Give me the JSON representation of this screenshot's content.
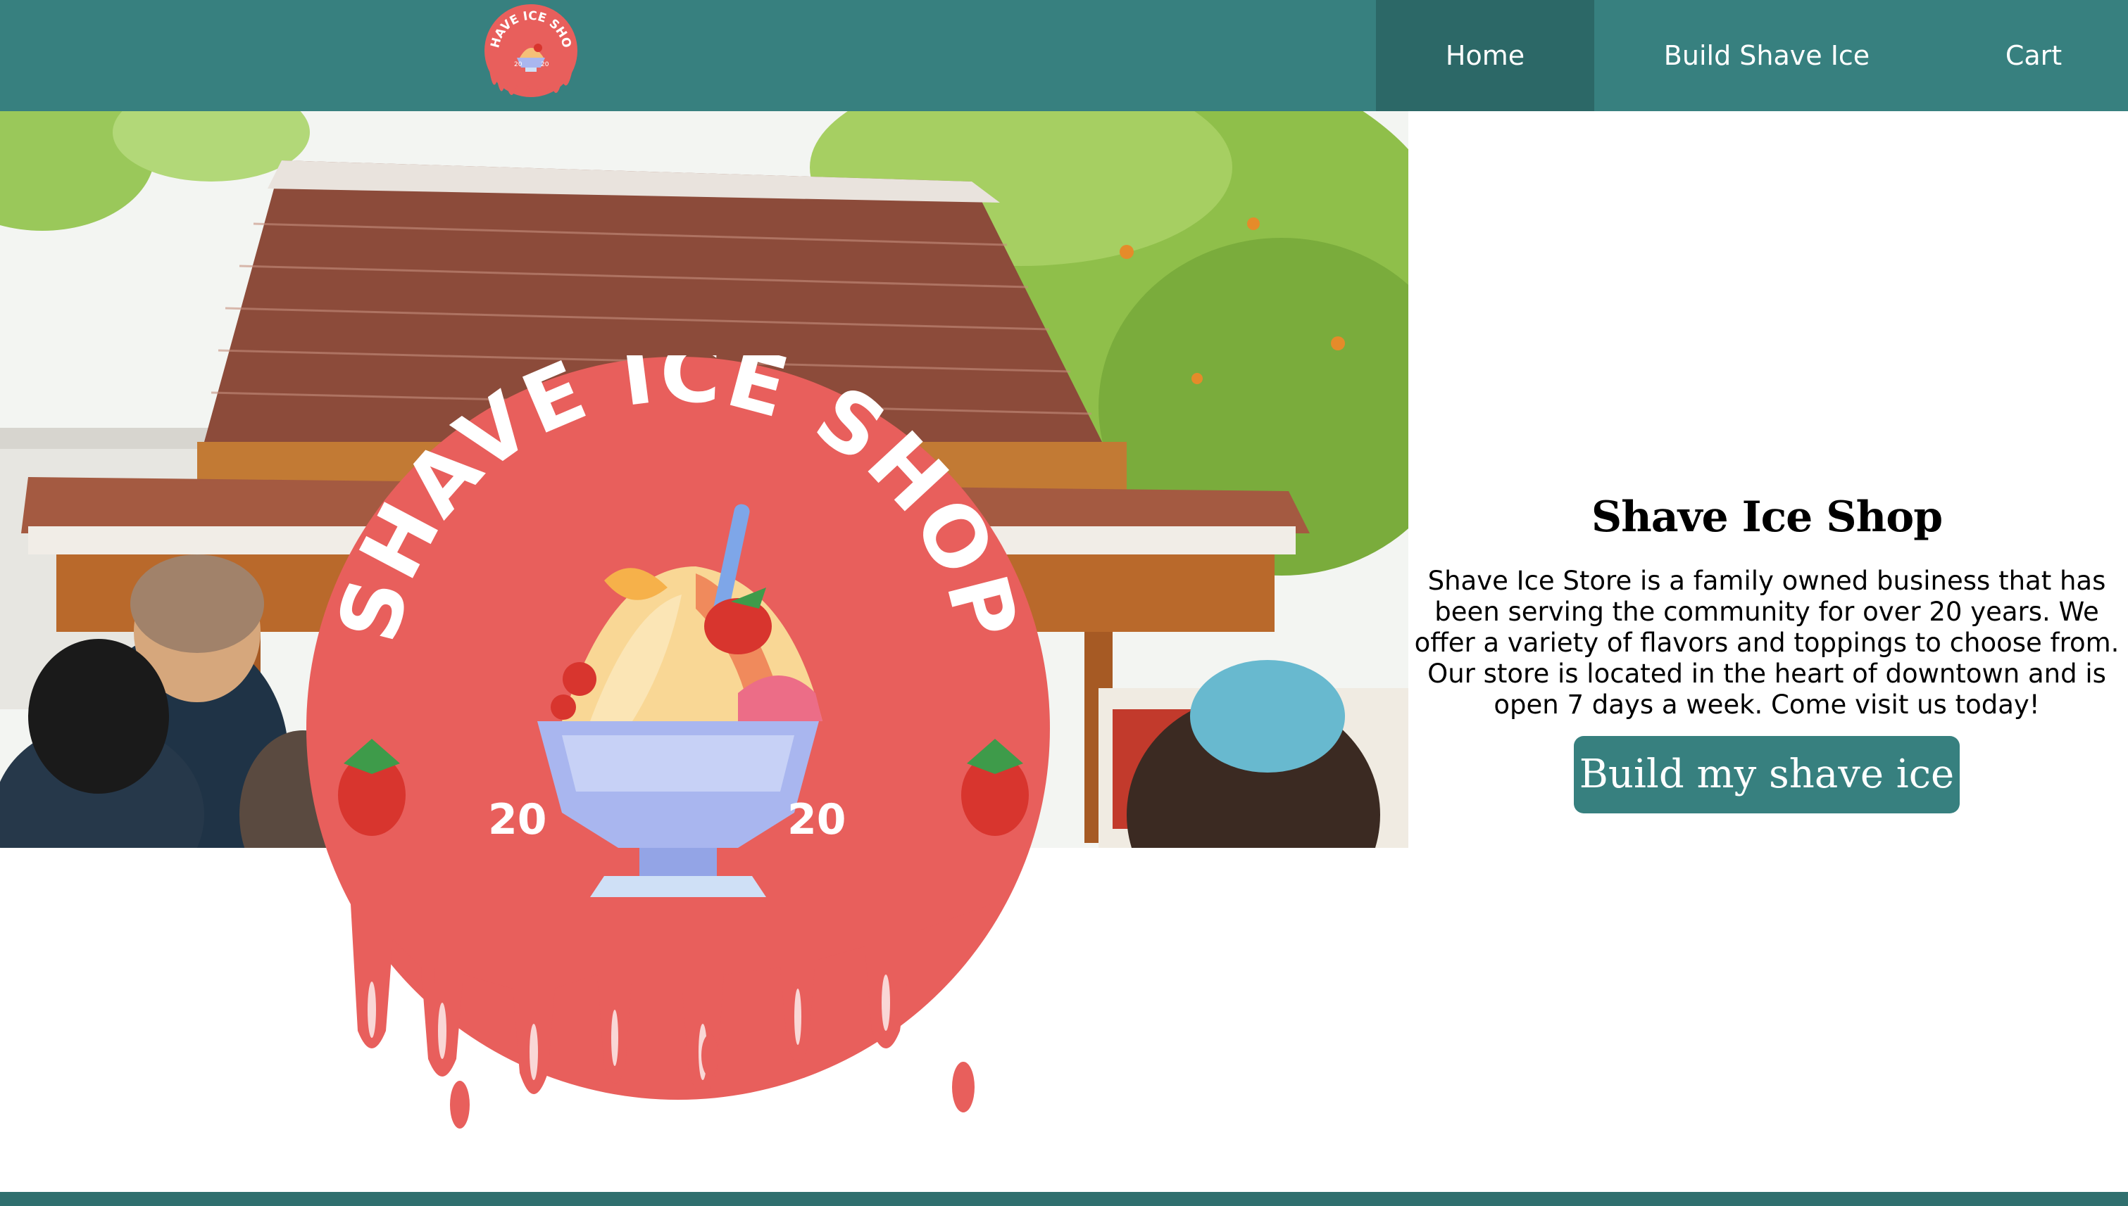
{
  "brand": {
    "logo_text": "SHAVE ICE SHOP",
    "logo_year_left": "20",
    "logo_year_right": "20",
    "primary_color": "#37807f",
    "active_nav_color": "#2c6867",
    "logo_red": "#e85f5c"
  },
  "nav": {
    "items": [
      {
        "label": "Home",
        "active": true
      },
      {
        "label": "Build Shave Ice",
        "active": false
      },
      {
        "label": "Cart",
        "active": false
      }
    ]
  },
  "hero": {
    "title": "Shave Ice Shop",
    "description": "Shave Ice Store is a family owned business that has been serving the community for over 20 years. We offer a variety of flavors and toppings to choose from. Our store is located in the heart of downtown and is open 7 days a week. Come visit us today!",
    "cta_label": "Build my shave ice"
  }
}
